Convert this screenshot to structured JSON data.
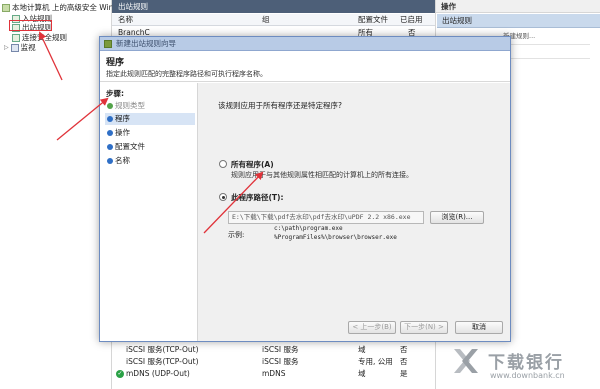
{
  "tree": {
    "root_label": "本地计算机 上的高级安全 Wind",
    "items": [
      {
        "label": "入站规则"
      },
      {
        "label": "出站规则"
      },
      {
        "label": "连接安全规则"
      },
      {
        "label": "监视"
      }
    ]
  },
  "middle": {
    "title": "出站规则",
    "columns": [
      "名称",
      "组",
      "配置文件",
      "已启用"
    ],
    "top_row": {
      "name": "BranchC",
      "config": "所有",
      "enabled": "否"
    },
    "rows": [
      {
        "name": "iSCSI 服务(TCP-Out)",
        "group": "iSCSI 服务",
        "config": "域",
        "enabled": "否"
      },
      {
        "name": "iSCSI 服务(TCP-Out)",
        "group": "iSCSI 服务",
        "config": "专用, 公用",
        "enabled": "否"
      },
      {
        "name": "mDNS (UDP-Out)",
        "group": "mDNS",
        "config": "域",
        "enabled": "是"
      }
    ]
  },
  "actions": {
    "title": "操作",
    "selected": "出站规则",
    "fragment": "新建规则..."
  },
  "dialog": {
    "title": "新建出站规则向导",
    "heading": "程序",
    "subheading": "指定此规则匹配的完整程序路径和可执行程序名称。",
    "steps_title": "步骤:",
    "steps": [
      "规则类型",
      "程序",
      "操作",
      "配置文件",
      "名称"
    ],
    "current_step": 1,
    "question": "该规则应用于所有程序还是特定程序?",
    "all_programs": {
      "label": "所有程序(A)",
      "desc": "规则应用于与其他规则属性相匹配的计算机上的所有连接。",
      "selected": false
    },
    "this_program": {
      "label": "此程序路径(T):",
      "selected": true
    },
    "program_path": "E:\\下载\\下载\\pdf去水印\\pdf去水印\\uPDF 2.2 x86.exe",
    "browse_label": "浏览(R)...",
    "example_label": "示例:",
    "examples": [
      "c:\\path\\program.exe",
      "%ProgramFiles%\\browser\\browser.exe"
    ],
    "back_label": "< 上一步(B)",
    "next_label": "下一步(N) >",
    "cancel_label": "取消"
  },
  "watermark": {
    "text": "下载银行",
    "url": "www.downbank.cn"
  },
  "colors": {
    "annotation": "#e0333a",
    "dialog_title_bg": "#b8cbe6",
    "selected_step_bg": "#d7e4f5"
  }
}
